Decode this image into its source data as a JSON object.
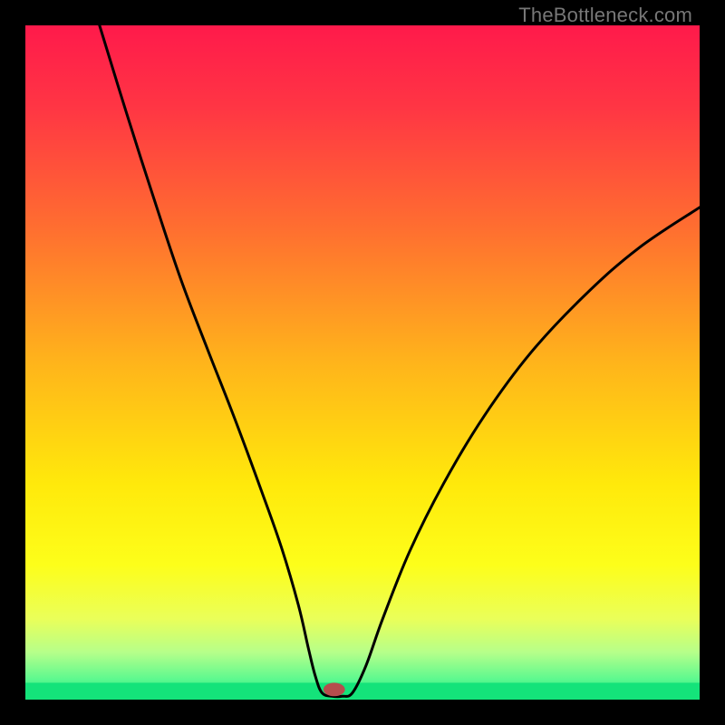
{
  "watermark": "TheBottleneck.com",
  "chart_data": {
    "type": "line",
    "title": "",
    "xlabel": "",
    "ylabel": "",
    "xlim": [
      0,
      100
    ],
    "ylim": [
      0,
      100
    ],
    "grid": false,
    "legend": false,
    "background_gradient_stops": [
      {
        "offset": 0.0,
        "color": "#ff1a4b"
      },
      {
        "offset": 0.12,
        "color": "#ff3544"
      },
      {
        "offset": 0.3,
        "color": "#ff6e30"
      },
      {
        "offset": 0.5,
        "color": "#ffb41b"
      },
      {
        "offset": 0.68,
        "color": "#ffe90b"
      },
      {
        "offset": 0.8,
        "color": "#fdfe1a"
      },
      {
        "offset": 0.88,
        "color": "#eaff59"
      },
      {
        "offset": 0.93,
        "color": "#b6ff8a"
      },
      {
        "offset": 0.97,
        "color": "#5cf98f"
      },
      {
        "offset": 1.0,
        "color": "#14e37a"
      }
    ],
    "bottom_band": {
      "y": 97.5,
      "height": 2.5,
      "color": "#14e37a"
    },
    "curve_points": [
      {
        "x": 11.0,
        "y": 100.0
      },
      {
        "x": 15.0,
        "y": 87.0
      },
      {
        "x": 19.0,
        "y": 74.5
      },
      {
        "x": 23.0,
        "y": 62.5
      },
      {
        "x": 27.0,
        "y": 52.0
      },
      {
        "x": 31.0,
        "y": 41.8
      },
      {
        "x": 35.0,
        "y": 31.0
      },
      {
        "x": 38.0,
        "y": 22.5
      },
      {
        "x": 40.5,
        "y": 14.0
      },
      {
        "x": 42.0,
        "y": 7.5
      },
      {
        "x": 43.0,
        "y": 3.5
      },
      {
        "x": 44.0,
        "y": 1.0
      },
      {
        "x": 45.5,
        "y": 0.5
      },
      {
        "x": 47.0,
        "y": 0.5
      },
      {
        "x": 48.5,
        "y": 1.0
      },
      {
        "x": 50.5,
        "y": 5.0
      },
      {
        "x": 53.0,
        "y": 12.0
      },
      {
        "x": 57.0,
        "y": 22.0
      },
      {
        "x": 62.0,
        "y": 32.0
      },
      {
        "x": 68.0,
        "y": 42.0
      },
      {
        "x": 75.0,
        "y": 51.5
      },
      {
        "x": 83.0,
        "y": 60.0
      },
      {
        "x": 91.0,
        "y": 67.0
      },
      {
        "x": 100.0,
        "y": 73.0
      }
    ],
    "marker": {
      "x": 45.8,
      "y": 1.5,
      "rx": 1.6,
      "ry": 1.0,
      "color": "#b64d4d"
    }
  }
}
